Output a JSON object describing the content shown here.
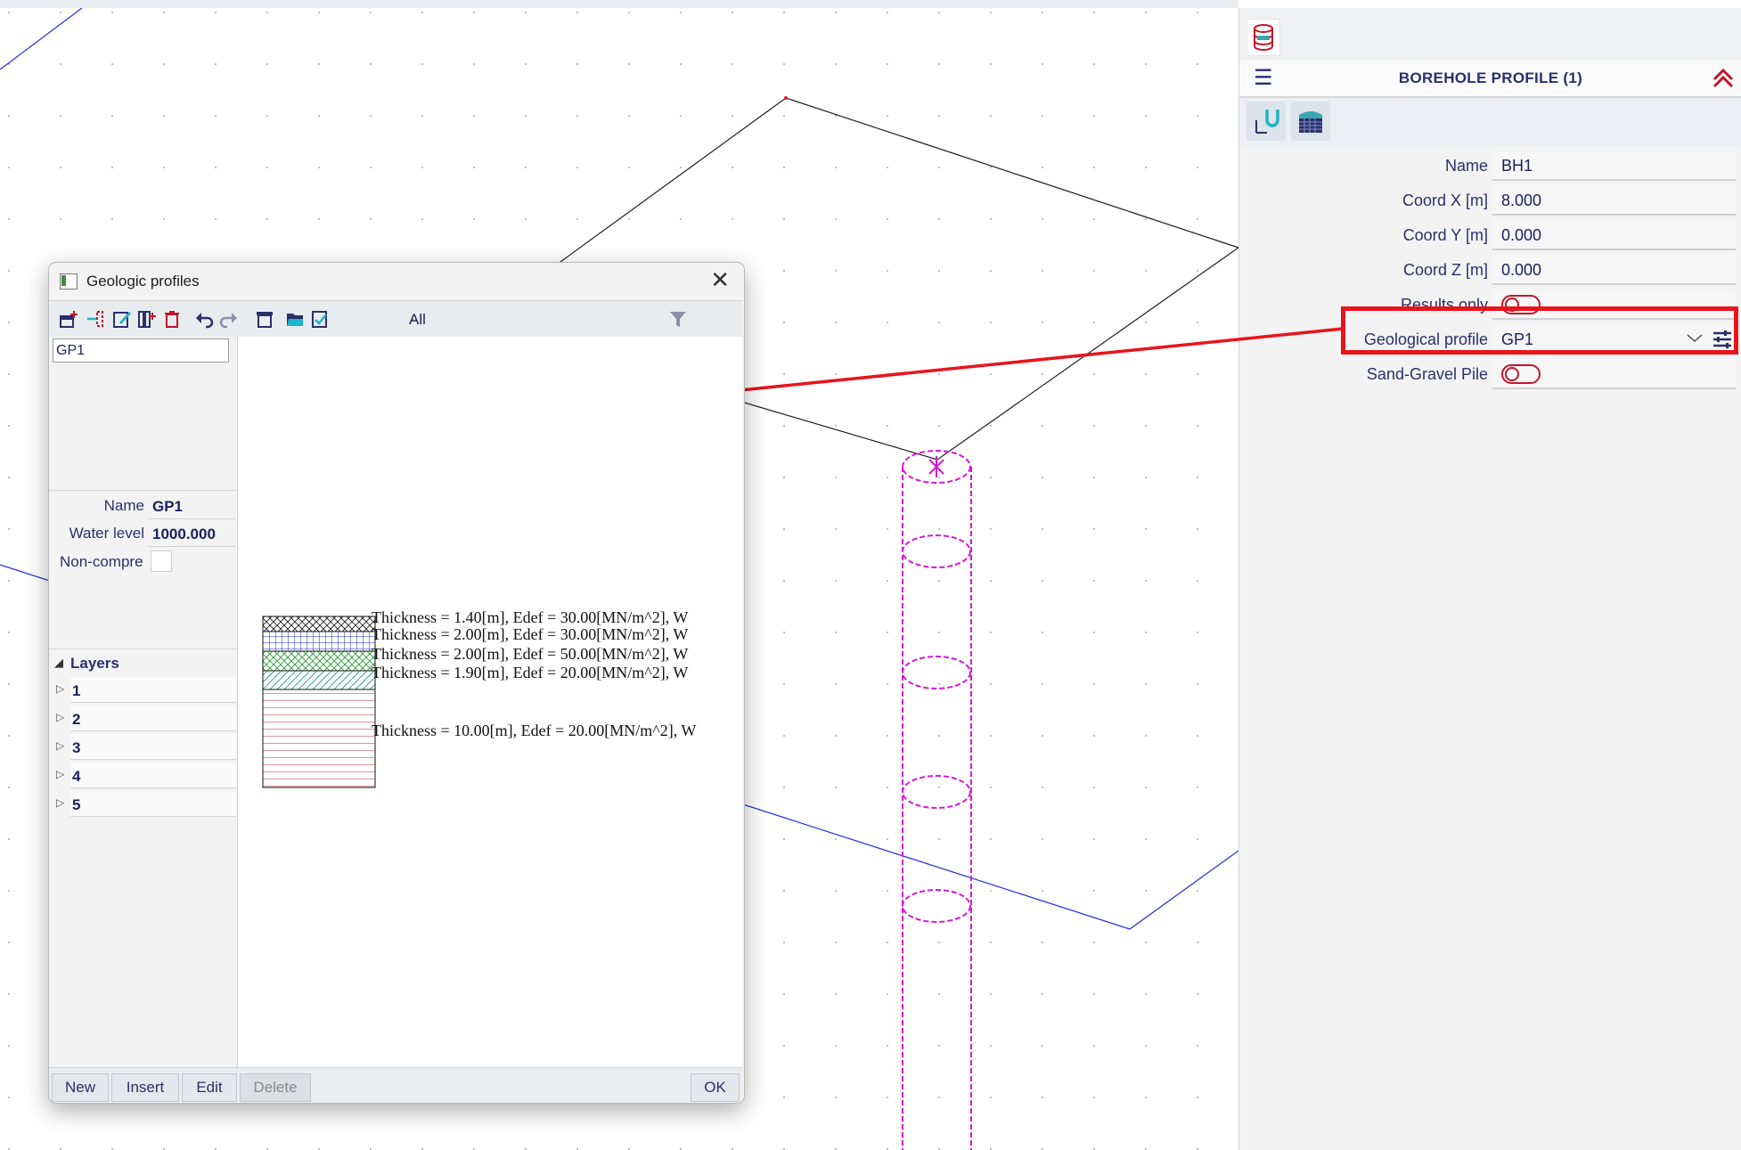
{
  "borehole_panel": {
    "title": "BOREHOLE PROFILE (1)",
    "menu_icon": "hamburger-icon",
    "collapse_icon": "double-chevron-up-icon",
    "top_icon": "database-icon",
    "tool_icons": [
      "local-axes-icon",
      "soil-profile-icon"
    ],
    "properties": {
      "name": {
        "label": "Name",
        "value": "BH1"
      },
      "coord_x": {
        "label": "Coord X [m]",
        "value": "8.000"
      },
      "coord_y": {
        "label": "Coord Y [m]",
        "value": "0.000"
      },
      "coord_z": {
        "label": "Coord Z [m]",
        "value": "0.000"
      },
      "results_only": {
        "label": "Results only",
        "on": false
      },
      "geological_profile": {
        "label": "Geological profile",
        "value": "GP1"
      },
      "sand_gravel_pile": {
        "label": "Sand-Gravel Pile",
        "on": false
      }
    },
    "accent_color": "#c0152b",
    "highlight_color": "#e8141c"
  },
  "dialog": {
    "title": "Geologic profiles",
    "toolbar": {
      "filter_value": "All",
      "icons": [
        "new-icon",
        "insert-icon",
        "edit-icon",
        "copy-icon",
        "delete-icon",
        "undo-icon",
        "redo-icon",
        "library-icon",
        "open-folder-icon",
        "check-icon",
        "filter-icon"
      ]
    },
    "list": [
      "GP1"
    ],
    "fields": {
      "name": {
        "label": "Name",
        "value": "GP1"
      },
      "water_level": {
        "label": "Water level",
        "value": "1000.000"
      },
      "non_compressible": {
        "label": "Non-compre"
      }
    },
    "layers_header": "Layers",
    "layers": [
      "1",
      "2",
      "3",
      "4",
      "5"
    ],
    "preview_lines": [
      "Thickness  = 1.40[m], Edef = 30.00[MN/m^2], W",
      "Thickness  = 2.00[m], Edef = 30.00[MN/m^2], W",
      "Thickness  = 2.00[m], Edef = 50.00[MN/m^2], W",
      "Thickness  = 1.90[m], Edef = 20.00[MN/m^2], W",
      "Thickness  = 10.00[m], Edef = 20.00[MN/m^2], W"
    ],
    "buttons": {
      "new": "New",
      "insert": "Insert",
      "edit": "Edit",
      "delete": "Delete",
      "ok": "OK"
    }
  },
  "colors": {
    "model_lines": "#1f1f1f",
    "axis_lines": "#2b35d6",
    "borehole": "#d617d6",
    "arrow": "#e8141c"
  }
}
